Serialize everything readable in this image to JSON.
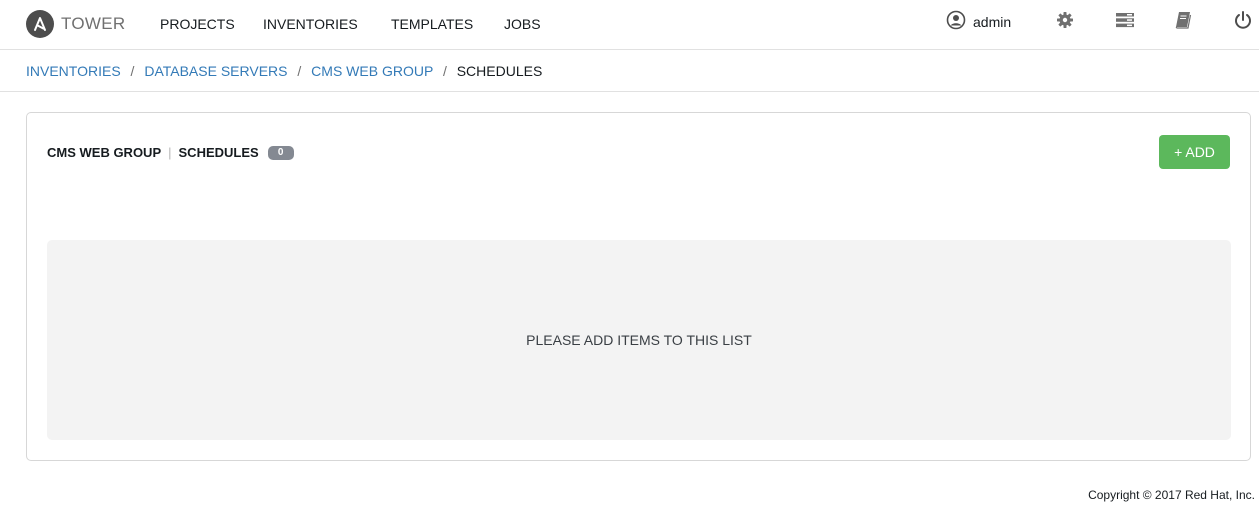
{
  "brand": {
    "name": "TOWER",
    "logo_letter": "A"
  },
  "nav": {
    "links": [
      "PROJECTS",
      "INVENTORIES",
      "TEMPLATES",
      "JOBS"
    ],
    "user": "admin",
    "icons": [
      "user-icon",
      "gear-icon",
      "portal-icon",
      "docs-icon",
      "power-icon"
    ]
  },
  "breadcrumb": {
    "items": [
      "INVENTORIES",
      "DATABASE SERVERS",
      "CMS WEB GROUP"
    ],
    "separator": "/",
    "current": "SCHEDULES"
  },
  "panel": {
    "title": "CMS WEB GROUP",
    "divider": "|",
    "section": "SCHEDULES",
    "count": "0",
    "add_label": "+ ADD",
    "empty_message": "PLEASE ADD ITEMS TO THIS LIST"
  },
  "footer": {
    "copyright": "Copyright © 2017 Red Hat, Inc."
  },
  "colors": {
    "link": "#337ab7",
    "add_button": "#5cb85c",
    "badge": "#848992",
    "empty_bg": "#f3f3f3"
  }
}
